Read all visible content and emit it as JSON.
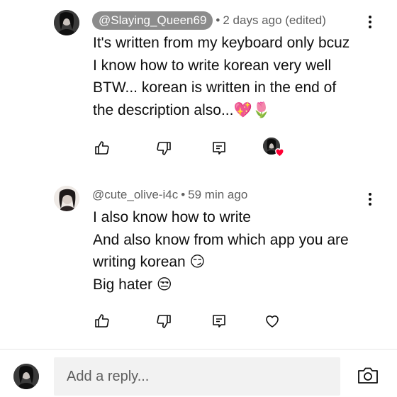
{
  "comments": [
    {
      "handle": "@Slaying_Queen69",
      "is_owner": true,
      "separator": "•",
      "time": "2 days ago (edited)",
      "lines": [
        "It's written from my keyboard only bcuz",
        "I know how to write korean very well",
        "BTW... korean is written in the end of",
        "the description also...💖🌷"
      ],
      "creator_heart": true
    },
    {
      "handle": "@cute_olive-i4c",
      "is_owner": false,
      "separator": "•",
      "time": "59 min ago",
      "lines": [
        "I also know how to write",
        "And also know from which app you are",
        "writing korean 😏",
        "Big hater 😒"
      ],
      "creator_heart": false
    }
  ],
  "reply": {
    "placeholder": "Add a reply..."
  },
  "icons": {
    "like": "thumbs-up-icon",
    "dislike": "thumbs-down-icon",
    "reply": "comment-icon",
    "heart": "heart-icon",
    "more": "more-vert-icon",
    "camera": "camera-icon"
  },
  "colors": {
    "owner_pill_bg": "#8c8c8c",
    "meta_text": "#606060",
    "heart_red": "#ff0033",
    "input_bg": "#f2f2f2"
  }
}
